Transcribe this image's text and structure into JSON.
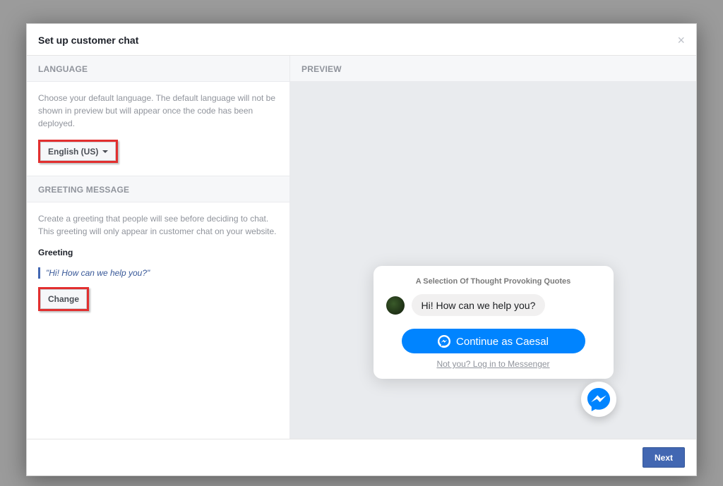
{
  "header": {
    "title": "Set up customer chat"
  },
  "language": {
    "section_label": "LANGUAGE",
    "description": "Choose your default language. The default language will not be shown in preview but will appear once the code has been deployed.",
    "selected": "English (US)"
  },
  "greeting": {
    "section_label": "GREETING MESSAGE",
    "description": "Create a greeting that people will see before deciding to chat. This greeting will only appear in customer chat on your website.",
    "field_label": "Greeting",
    "text": "\"Hi! How can we help you?\"",
    "change_label": "Change"
  },
  "preview": {
    "section_label": "PREVIEW",
    "page_title": "A Selection Of Thought Provoking Quotes",
    "greeting_bubble": "Hi! How can we help you?",
    "continue_label": "Continue as Caesal",
    "not_you_text": "Not you? Log in to Messenger"
  },
  "footer": {
    "next_label": "Next"
  }
}
